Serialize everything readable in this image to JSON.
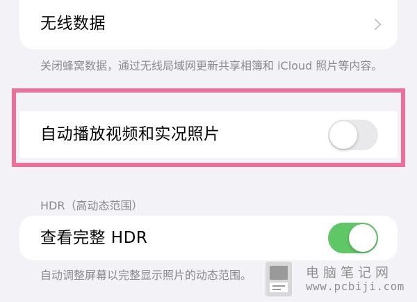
{
  "wireless_data": {
    "label": "无线数据",
    "footnote": "关闭蜂窝数据，通过无线局域网更新共享相簿和 iCloud 照片等内容。"
  },
  "autoplay": {
    "label": "自动播放视频和实况照片",
    "toggle_state": "off"
  },
  "hdr_section": {
    "header": "HDR（高动态范围）",
    "row_label": "查看完整 HDR",
    "toggle_state": "on",
    "footnote": "自动调整屏幕以完整显示照片的动态范围。"
  },
  "watermark": {
    "title": "电脑笔记网",
    "url": "www.pcbiji.com"
  },
  "colors": {
    "background": "#f2f2f7",
    "toggle_on": "#5fc765",
    "toggle_off": "#e9e9eb",
    "highlight": "#f06f98",
    "secondary_text": "#8a8a8e"
  },
  "icons": {
    "chevron": "chevron-right-icon",
    "logo": "pcbiji-logo-icon"
  }
}
